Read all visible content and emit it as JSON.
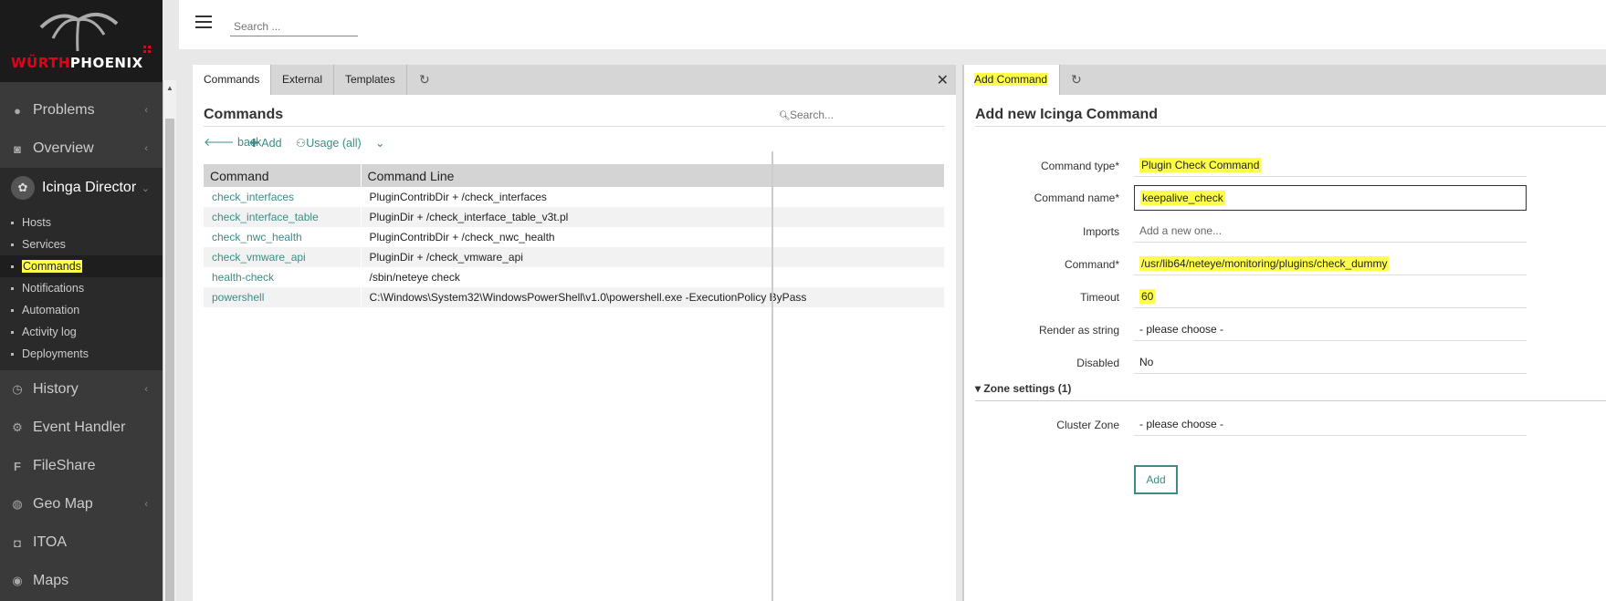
{
  "brand": {
    "logo_part1": "WÜRTH",
    "logo_part2": "PHOENIX"
  },
  "header": {
    "search_placeholder": "Search ..."
  },
  "sidebar": {
    "items": [
      {
        "label": "Problems",
        "icon": "warning-icon"
      },
      {
        "label": "Overview",
        "icon": "eye-icon"
      },
      {
        "label": "Icinga Director",
        "icon": "director-icon"
      }
    ],
    "director_sub": [
      "Hosts",
      "Services",
      "Commands",
      "Notifications",
      "Automation",
      "Activity log",
      "Deployments"
    ],
    "items_after": [
      {
        "label": "History",
        "icon": "history-icon"
      },
      {
        "label": "Event Handler",
        "icon": "gear-icon"
      },
      {
        "label": "FileShare",
        "icon": "f-icon"
      },
      {
        "label": "Geo Map",
        "icon": "globe-icon"
      },
      {
        "label": "ITOA",
        "icon": "chart-icon"
      },
      {
        "label": "Maps",
        "icon": "map-icon"
      }
    ]
  },
  "left": {
    "tabs": [
      "Commands",
      "External",
      "Templates"
    ],
    "title": "Commands",
    "search_placeholder": "Search...",
    "actions": {
      "back": "back",
      "add": "Add",
      "usage": "Usage (all)"
    },
    "table": {
      "headers": [
        "Command",
        "Command Line"
      ],
      "rows": [
        {
          "name": "check_interfaces",
          "line": "PluginContribDir + /check_interfaces"
        },
        {
          "name": "check_interface_table",
          "line": "PluginDir + /check_interface_table_v3t.pl"
        },
        {
          "name": "check_nwc_health",
          "line": "PluginContribDir + /check_nwc_health"
        },
        {
          "name": "check_vmware_api",
          "line": "PluginDir + /check_vmware_api"
        },
        {
          "name": "health-check",
          "line": "/sbin/neteye check"
        },
        {
          "name": "powershell",
          "line": "C:\\Windows\\System32\\WindowsPowerShell\\v1.0\\powershell.exe -ExecutionPolicy ByPass"
        }
      ]
    }
  },
  "right": {
    "tab": "Add Command",
    "title": "Add new Icinga Command",
    "fields": {
      "command_type": {
        "label": "Command type*",
        "value": "Plugin Check Command"
      },
      "command_name": {
        "label": "Command name*",
        "value": "keepalive_check"
      },
      "imports": {
        "label": "Imports",
        "placeholder": "Add a new one..."
      },
      "command": {
        "label": "Command*",
        "value": "/usr/lib64/neteye/monitoring/plugins/check_dummy"
      },
      "timeout": {
        "label": "Timeout",
        "value": "60"
      },
      "render_as_string": {
        "label": "Render as string",
        "value": "- please choose -"
      },
      "disabled": {
        "label": "Disabled",
        "value": "No"
      }
    },
    "zone_settings": "Zone settings (1)",
    "cluster_zone": {
      "label": "Cluster Zone",
      "value": "- please choose -"
    },
    "submit": "Add"
  }
}
